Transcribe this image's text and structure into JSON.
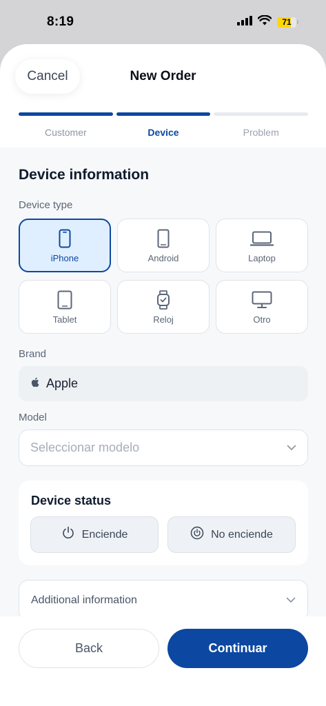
{
  "status_bar": {
    "time": "8:19",
    "battery_level": "71"
  },
  "header": {
    "cancel_label": "Cancel",
    "title": "New Order"
  },
  "steps": [
    {
      "label": "Customer",
      "state": "done"
    },
    {
      "label": "Device",
      "state": "current"
    },
    {
      "label": "Problem",
      "state": "pending"
    }
  ],
  "form": {
    "section_title": "Device information",
    "device_type_label": "Device type",
    "device_types": [
      {
        "label": "iPhone",
        "icon": "iphone-icon",
        "selected": true
      },
      {
        "label": "Android",
        "icon": "android-phone-icon",
        "selected": false
      },
      {
        "label": "Laptop",
        "icon": "laptop-icon",
        "selected": false
      },
      {
        "label": "Tablet",
        "icon": "tablet-icon",
        "selected": false
      },
      {
        "label": "Reloj",
        "icon": "watch-icon",
        "selected": false
      },
      {
        "label": "Otro",
        "icon": "monitor-icon",
        "selected": false
      }
    ],
    "brand_label": "Brand",
    "brand_value": "Apple",
    "model_label": "Model",
    "model_placeholder": "Seleccionar modelo",
    "device_status": {
      "title": "Device status",
      "on_label": "Enciende",
      "off_label": "No enciende"
    },
    "additional_label": "Additional information"
  },
  "footer": {
    "back_label": "Back",
    "continue_label": "Continuar"
  },
  "colors": {
    "primary": "#0c47a1",
    "selected_bg": "#e0efff"
  }
}
